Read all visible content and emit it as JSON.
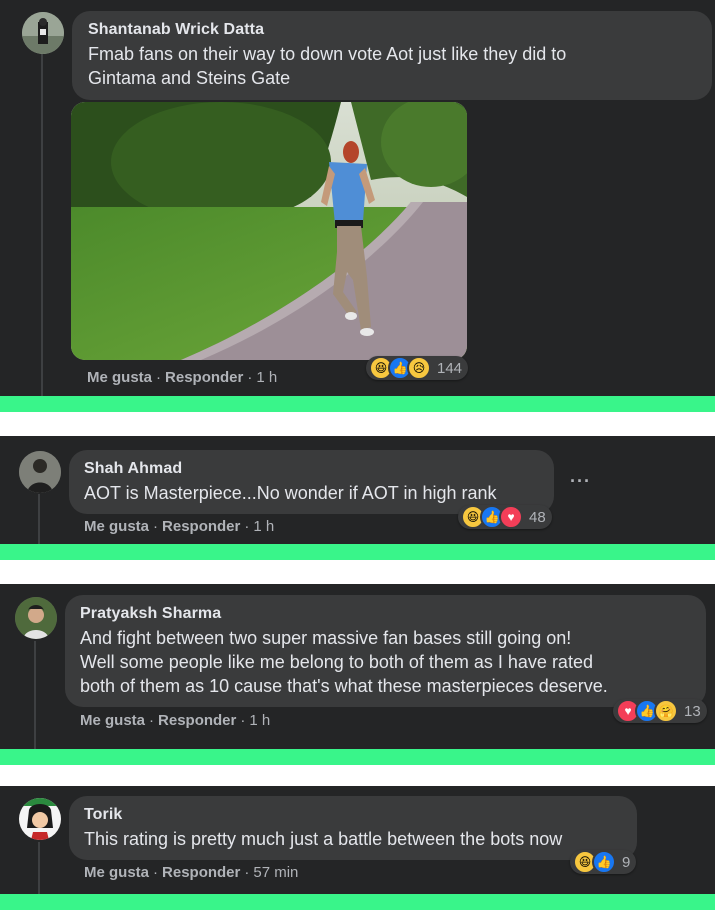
{
  "comments": [
    {
      "name": "Shantanab Wrick Datta",
      "text_lines": [
        "Fmab fans on their way to down vote Aot just like they did to",
        "Gintama and Steins Gate"
      ],
      "like": "Me gusta",
      "reply": "Responder",
      "time": "1 h",
      "reactions": [
        "haha-icon",
        "like-icon",
        "sad-icon"
      ],
      "count": "144"
    },
    {
      "name": "Shah Ahmad",
      "text_lines": [
        "AOT is Masterpiece...No wonder if AOT in high rank"
      ],
      "like": "Me gusta",
      "reply": "Responder",
      "time": "1 h",
      "reactions": [
        "haha-icon",
        "like-icon",
        "love-icon"
      ],
      "count": "48",
      "more": "···"
    },
    {
      "name": "Pratyaksh Sharma",
      "text_lines": [
        "And fight between two super massive fan bases still going on!",
        "Well some people like me belong to both of them as I have rated",
        "both of them as 10 cause that's what these masterpieces deserve."
      ],
      "like": "Me gusta",
      "reply": "Responder",
      "time": "1 h",
      "reactions": [
        "love-icon",
        "like-icon",
        "care-icon"
      ],
      "count": "13"
    },
    {
      "name": "Torik",
      "text_lines": [
        "This rating is pretty much just a battle between the bots now"
      ],
      "like": "Me gusta",
      "reply": "Responder",
      "time": "57 min",
      "reactions": [
        "haha-icon",
        "like-icon"
      ],
      "count": "9"
    }
  ],
  "colors": {
    "panel": "#242526",
    "bubble": "#3a3b3c",
    "strip": "#39f58a",
    "text": "#e4e6eb",
    "secondary": "#b0b3b8"
  }
}
